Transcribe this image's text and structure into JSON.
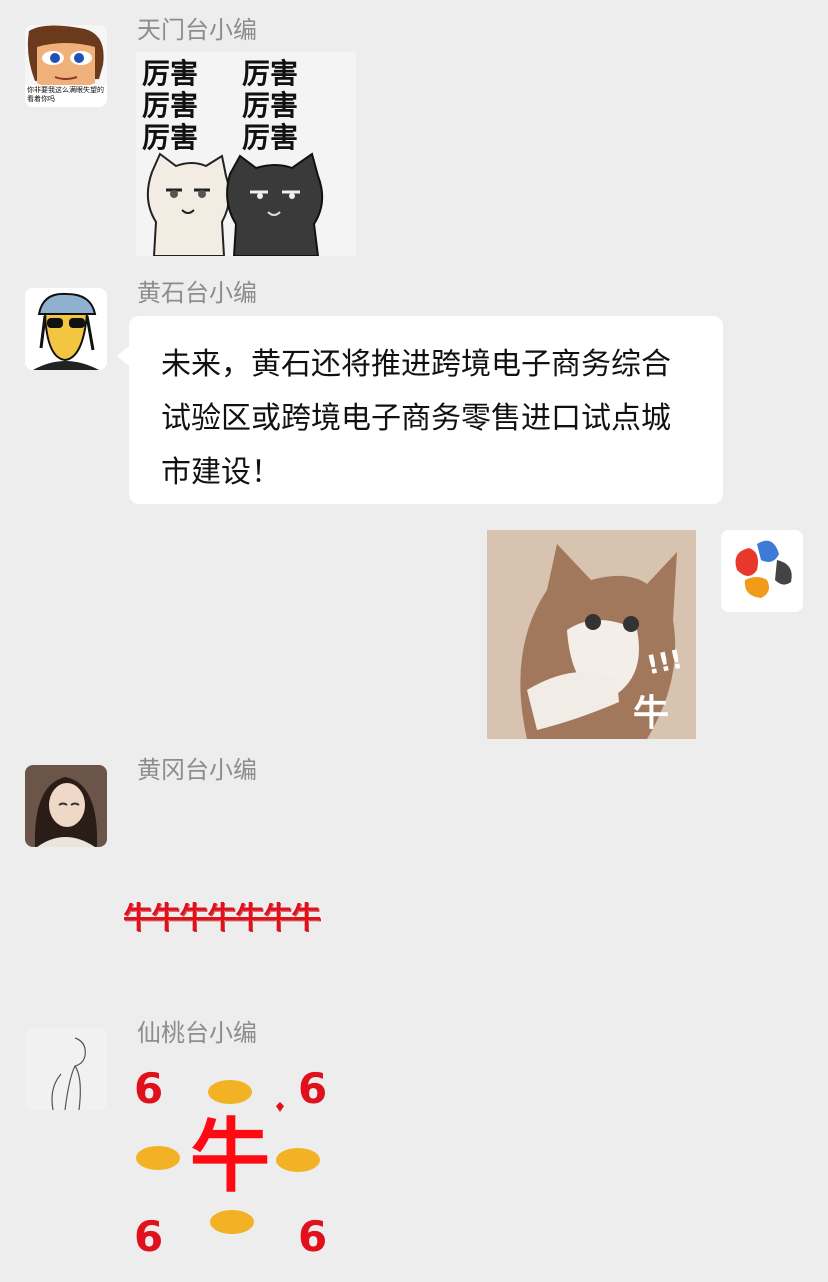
{
  "messages": [
    {
      "sender": "天门台小编",
      "avatar_caption": "你非要我这么满眼失望的看着你吗",
      "sticker_text": [
        "厉害",
        "厉害",
        "厉害",
        "厉害",
        "厉害",
        "厉害"
      ]
    },
    {
      "sender": "黄石台小编",
      "text": "未来，黄石还将推进跨境电子商务综合试验区或跨境电子商务零售进口试点城市建设！"
    },
    {
      "sender": "",
      "sticker_text": "牛",
      "sticker_marks": "!!!"
    },
    {
      "sender": "黄冈台小编",
      "sticker_text": "牛牛牛牛牛牛牛"
    },
    {
      "sender": "仙桃台小编",
      "sticker_text": "牛",
      "sticker_sixes": [
        "6",
        "6",
        "6",
        "6"
      ]
    }
  ],
  "colors": {
    "background": "#ededed",
    "bubble": "#ffffff",
    "sender_name": "#8d8d8d",
    "niu_red": "#e0101c"
  }
}
